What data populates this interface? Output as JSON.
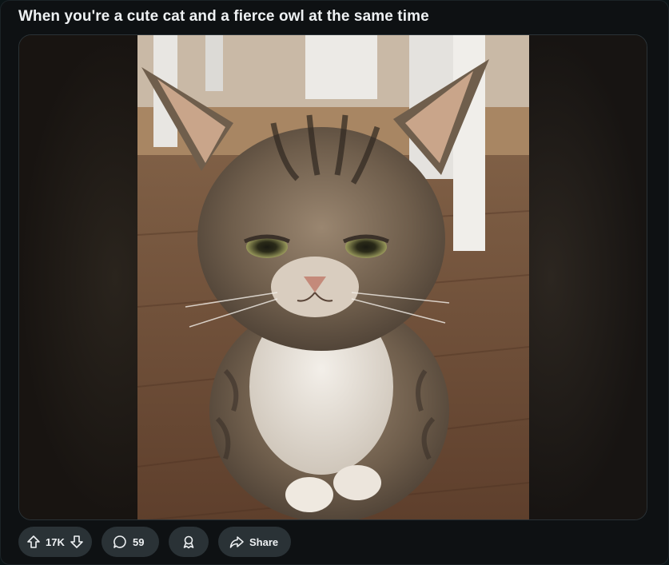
{
  "post": {
    "title": "When you're a cute cat and a fierce owl at the same time"
  },
  "media": {
    "alt": "tabby kitten with raised ears and a grumpy expression"
  },
  "actions": {
    "vote_count": "17K",
    "comment_count": "59",
    "share_label": "Share"
  },
  "icons": {
    "upvote": "arrow-up-icon",
    "downvote": "arrow-down-icon",
    "comments": "comment-bubble-icon",
    "award": "award-icon",
    "share": "share-arrow-icon"
  },
  "colors": {
    "background": "#0e1113",
    "pill": "#2a3236",
    "text": "#eef1f3"
  }
}
